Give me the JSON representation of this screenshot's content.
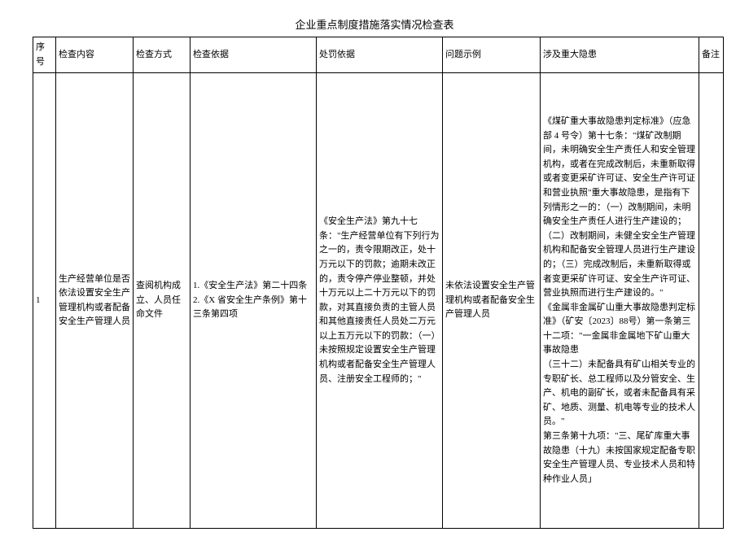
{
  "title": "企业重点制度措施落实情况检查表",
  "headers": {
    "seq": "序号",
    "content": "检查内容",
    "method": "检查方式",
    "basis": "检查依据",
    "penalty": "处罚依据",
    "example": "问题示例",
    "hazard": "涉及重大隐患",
    "remark": "备注"
  },
  "rows": [
    {
      "seq": "1",
      "content": "生产经营单位是否依法设置安全生产管理机构或者配备安全生产管理人员",
      "method": "查阅机构成立、人员任命文件",
      "basis": "1.《安全生产法》第二十四条\n2.《X 省安全生产条例》第十三条第四项",
      "penalty": "《安全生产法》第九十七条：\"生产经营单位有下列行为之一的，责令限期改正，处十万元以下的罚款；逾期未改正的，责令停产停业整顿，并处十万元以上二十万元以下的罚款，对其直接负责的主管人员和其他直接责任人员处二万元以上五万元以下的罚款：（一）未按照规定设置安全生产管理机构或者配备安全生产管理人员、注册安全工程师的；\"",
      "example": "未依法设置安全生产管理机构或者配备安全生产管理人员",
      "hazard": "《煤矿重大事故隐患判定标准》（应急部 4 号令）第十七条：\"煤矿改制期间，未明确安全生产责任人和安全管理机构，或者在完成改制后，未重新取得或者变更采矿许可证、安全生产许可证和营业执照\"重大事故隐患，是指有下列情形之一的：（一）改制期间，未明确安全生产责任人进行生产建设的；（二）改制期间，未健全安全生产管理机构和配备安全管理人员进行生产建设的；（三）完成改制后，未重新取得或者变更采矿许可证、安全生产许可证、营业执照而进行生产建设的。\"\n《金属非金属矿山重大事故隐患判定标准》（矿安〔2023〕88号）第一条第三十二项：\"一金属非金属地下矿山重大事故隐患\n（三十二）未配备具有矿山相关专业的专职矿长、总工程师以及分管安全、生产、机电的副矿长，或者未配备具有采矿、地质、测量、机电等专业的技术人员。\"\n第三条第十九项：\"三、尾矿库重大事故隐患（十九）未按国家规定配备专职安全生产管理人员、专业技术人员和特种作业人员」",
      "remark": ""
    }
  ]
}
